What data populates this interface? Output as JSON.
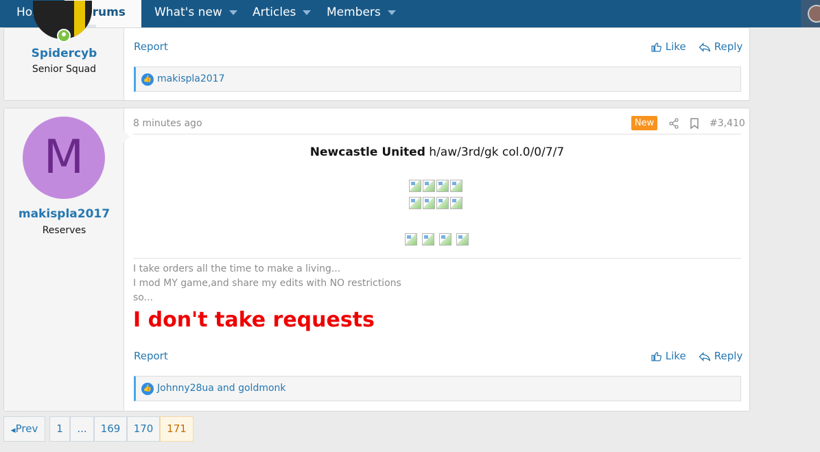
{
  "nav": {
    "items": [
      {
        "label": "Home"
      },
      {
        "label": "Forums"
      },
      {
        "label": "What's new"
      },
      {
        "label": "Articles"
      },
      {
        "label": "Members"
      }
    ]
  },
  "post1": {
    "username": "Spidercyb",
    "user_title": "Senior Squad",
    "report": "Report",
    "like": "Like",
    "reply": "Reply",
    "reactions": "makispla2017"
  },
  "post2": {
    "avatar_letter": "M",
    "username": "makispla2017",
    "user_title": "Reserves",
    "time": "8 minutes ago",
    "badge": "New",
    "number": "#3,410",
    "team": "Newcastle United",
    "team_info": " h/aw/3rd/gk col.0/0/7/7",
    "sig_lines": [
      "I take orders all the time to make a living...",
      "I mod MY game,and share my edits with NO restrictions",
      "so..."
    ],
    "sig_big": "I don't take requests",
    "report": "Report",
    "like": "Like",
    "reply": "Reply",
    "reactions": "Johnny28ua and goldmonk"
  },
  "pagination": {
    "prev": "Prev",
    "pages": [
      "1",
      "...",
      "169",
      "170",
      "171"
    ],
    "current": "171"
  },
  "colors": {
    "nav_bg": "#185886",
    "link": "#2577b1",
    "badge": "#f7931e",
    "sig_red": "#ee0000"
  }
}
